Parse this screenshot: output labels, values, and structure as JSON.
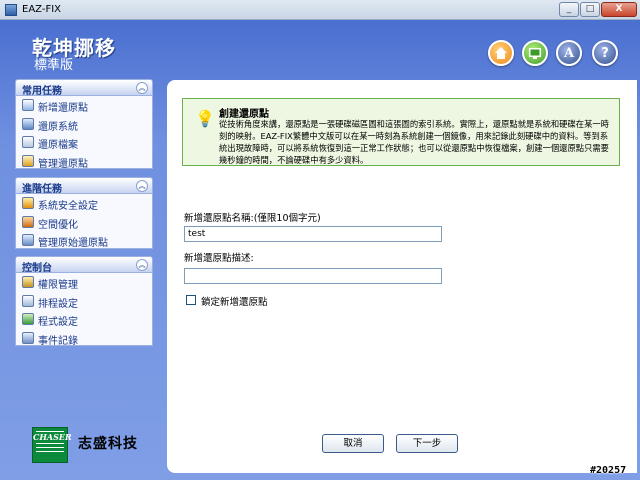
{
  "window": {
    "title": "EAZ-FIX",
    "minimize": "_",
    "maximize": "□",
    "close": "X"
  },
  "brand": {
    "title": "乾坤挪移",
    "subtitle": "標準版"
  },
  "top_icons": [
    "home-icon",
    "web-icon",
    "about-icon",
    "help-icon"
  ],
  "sidebar": {
    "common_tasks": {
      "title": "常用任務",
      "items": [
        {
          "label": "新增還原點",
          "icon": "restore-point-icon"
        },
        {
          "label": "還原系統",
          "icon": "restore-system-icon"
        },
        {
          "label": "還原檔案",
          "icon": "restore-file-icon"
        },
        {
          "label": "管理還原點",
          "icon": "manage-restore-icon"
        }
      ]
    },
    "advanced_tasks": {
      "title": "進階任務",
      "items": [
        {
          "label": "系統安全設定",
          "icon": "security-icon"
        },
        {
          "label": "空間優化",
          "icon": "space-optimize-icon"
        },
        {
          "label": "管理原始還原點",
          "icon": "original-restore-icon"
        }
      ]
    },
    "control_panel": {
      "title": "控制台",
      "items": [
        {
          "label": "權限管理",
          "icon": "permission-icon"
        },
        {
          "label": "排程設定",
          "icon": "schedule-icon"
        },
        {
          "label": "程式設定",
          "icon": "program-settings-icon"
        },
        {
          "label": "事件記錄",
          "icon": "event-log-icon"
        }
      ]
    }
  },
  "company": {
    "logo_text": "CHASER",
    "name": "志盛科技"
  },
  "info": {
    "title": "創建還原點",
    "text": "從技術角度來講，還原點是一張硬碟磁區圖和這張圖的索引系統。實際上，還原點就是系統和硬碟在某一時刻的映射。EAZ-FIX繁體中文版可以在某一時刻為系統創建一個鏡像，用來記錄此刻硬碟中的資料。等到系統出現故障時，可以將系統恢復到這一正常工作狀態；也可以從還原點中恢復檔案，創建一個還原點只需要幾秒鐘的時間，不論硬碟中有多少資料。"
  },
  "form": {
    "name_label": "新增還原點名稱:(僅限10個字元)",
    "name_value": "test",
    "desc_label": "新增還原點描述:",
    "desc_value": "",
    "lock_label": "鎖定新增還原點",
    "lock_checked": false
  },
  "buttons": {
    "cancel": "取消",
    "next": "下一步"
  },
  "watermark": "#20257",
  "colors": {
    "frame": "#6f8fe0",
    "panel_title": "#1a3a8a",
    "info_bg": "#eef7e2",
    "info_border": "#6ab04c",
    "logo": "#0c8a3c"
  }
}
